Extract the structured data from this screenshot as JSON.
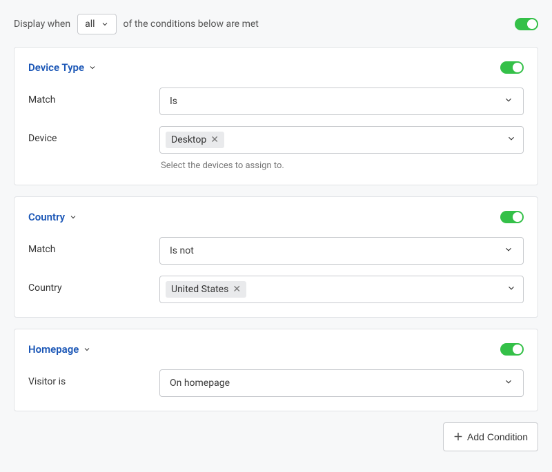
{
  "header": {
    "prefix": "Display when",
    "mode": "all",
    "suffix": "of the conditions below are met",
    "enabled": true
  },
  "conditions": [
    {
      "title": "Device Type",
      "enabled": true,
      "fields": {
        "match_label": "Match",
        "match_value": "Is",
        "device_label": "Device",
        "device_chip": "Desktop",
        "device_helper": "Select the devices to assign to."
      }
    },
    {
      "title": "Country",
      "enabled": true,
      "fields": {
        "match_label": "Match",
        "match_value": "Is not",
        "country_label": "Country",
        "country_chip": "United States"
      }
    },
    {
      "title": "Homepage",
      "enabled": true,
      "fields": {
        "visitor_label": "Visitor is",
        "visitor_value": "On homepage"
      }
    }
  ],
  "footer": {
    "add_label": "Add Condition"
  }
}
